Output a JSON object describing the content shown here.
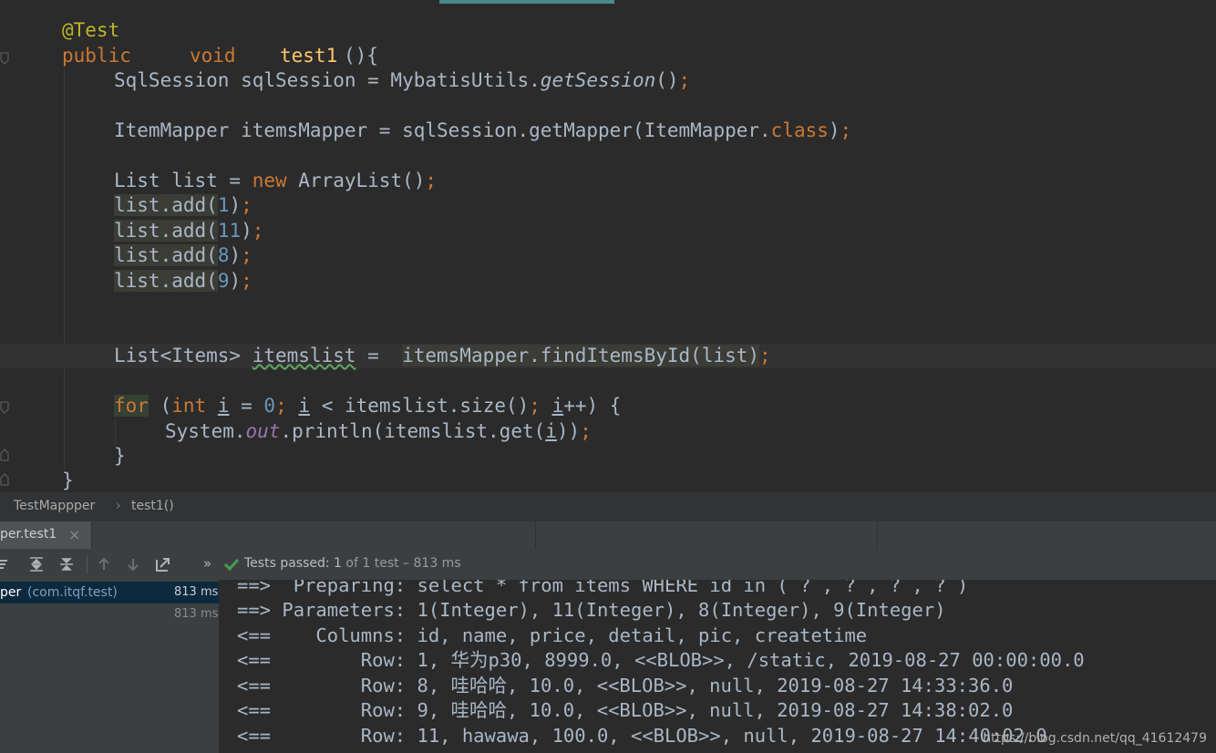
{
  "editor": {
    "lines": [
      {
        "annotation": "@Test"
      },
      {
        "kw_public": "public",
        "kw_void": "void",
        "method_name": "test1",
        "rest": "(){"
      },
      {
        "text": "SqlSession sqlSession = MybatisUtils.",
        "call": "getSession",
        "end": "()",
        "semi": ";"
      },
      {
        "a": "ItemMapper itemsMapper = sqlSession.getMapper(ItemMapper.",
        "kw": "class",
        "b": ")",
        "semi": ";"
      },
      {
        "a": "List list = ",
        "kw": "new",
        "b": " ArrayList()",
        "semi": ";"
      },
      {
        "obj": "list.add",
        "lp": "(",
        "num": "1",
        "rp": ")",
        "semi": ";"
      },
      {
        "obj": "list.add",
        "lp": "(",
        "num": "11",
        "rp": ")",
        "semi": ";"
      },
      {
        "obj": "list.add",
        "lp": "(",
        "num": "8",
        "rp": ")",
        "semi": ";"
      },
      {
        "obj": "list.add",
        "lp": "(",
        "num": "9",
        "rp": ")",
        "semi": ";"
      },
      {
        "a": "List<Items> ",
        "var": "itemslist",
        "eq": " =  ",
        "call": "itemsMapper.findItemsById(list)",
        "semi": ";"
      },
      {
        "kw_for": "for",
        "p1": " (",
        "kw_int": "int",
        "sp": " ",
        "i1": "i",
        "p2": " = ",
        "zero": "0",
        "s1": ";",
        "sp2": " ",
        "i2": "i",
        "p3": " < itemslist.size()",
        "s2": ";",
        "sp3": " ",
        "i3": "i",
        "p4": "++) {"
      },
      {
        "a": "System.",
        "field": "out",
        "b": ".println(itemslist.get(",
        "i": "i",
        "c": "))",
        "semi": ";"
      },
      {
        "text": "}"
      },
      {
        "text": "}"
      }
    ]
  },
  "breadcrumb": {
    "items": [
      "TestMappper",
      "test1()"
    ],
    "separator": "›"
  },
  "run_tabs": {
    "active": "per.test1",
    "close_glyph": "×"
  },
  "toolbar": {
    "more_glyph": "»",
    "status_prefix": "Tests passed: ",
    "status_count": "1",
    "status_of": " of 1 test",
    "status_time": " – 813 ms"
  },
  "test_tree": {
    "rows": [
      {
        "label": "per",
        "package": "(com.itqf.test)",
        "time": "813 ms"
      },
      {
        "label": "",
        "package": "",
        "time": "813 ms"
      }
    ]
  },
  "console": {
    "lines": [
      "==>  Preparing: select * from items WHERE id in ( ? , ? , ? , ? )",
      "==> Parameters: 1(Integer), 11(Integer), 8(Integer), 9(Integer)",
      "<==    Columns: id, name, price, detail, pic, createtime",
      "<==        Row: 1, 华为p30, 8999.0, <<BLOB>>, /static, 2019-08-27 00:00:00.0",
      "<==        Row: 8, 哇哈哈, 10.0, <<BLOB>>, null, 2019-08-27 14:33:36.0",
      "<==        Row: 9, 哇哈哈, 10.0, <<BLOB>>, null, 2019-08-27 14:38:02.0",
      "<==        Row: 11, hawawa, 100.0, <<BLOB>>, null, 2019-08-27 14:40:02.0"
    ]
  },
  "watermark": "https://blog.csdn.net/qq_41612479",
  "colors": {
    "background": "#2b2b2b",
    "keyword": "#cc7832",
    "annotation": "#bbb529",
    "method_decl": "#ffc66d",
    "number": "#6897bb",
    "default_text": "#a9b7c6",
    "static_field": "#9876aa",
    "success": "#499c54"
  }
}
